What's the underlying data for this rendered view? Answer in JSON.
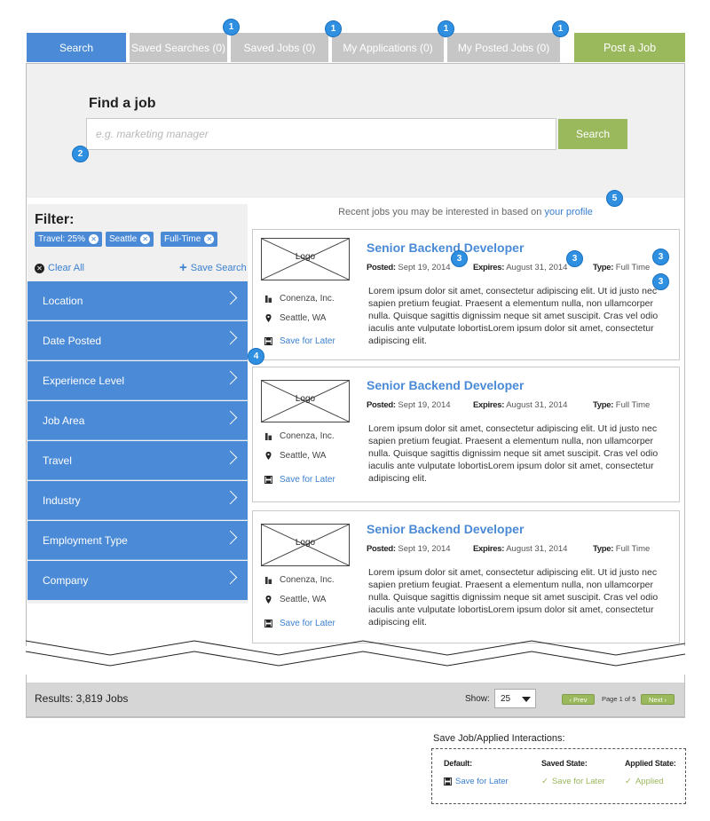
{
  "tabs": [
    {
      "label": "Search",
      "badge": ""
    },
    {
      "label": "Saved Searches (0)",
      "badge": "1"
    },
    {
      "label": "Saved Jobs (0)",
      "badge": "1"
    },
    {
      "label": "My Applications (0)",
      "badge": "1"
    },
    {
      "label": "My Posted Jobs (0)",
      "badge": "1"
    }
  ],
  "post_job_label": "Post a Job",
  "search": {
    "title": "Find a job",
    "placeholder": "e.g. marketing manager",
    "button_label": "Search",
    "badge": "2"
  },
  "filter": {
    "title": "Filter:",
    "chips": [
      "Travel: 25%",
      "Seattle",
      "Full-Time"
    ],
    "clear_all": "Clear All",
    "save_search": "Save Search",
    "facets": [
      "Location",
      "Date Posted",
      "Experience Level",
      "Job Area",
      "Travel",
      "Industry",
      "Employment Type",
      "Company"
    ]
  },
  "recent": {
    "text": "Recent jobs you may be interested in based on ",
    "link": "your profile",
    "badge": "5"
  },
  "jobs": [
    {
      "logo": "Logo",
      "title": "Senior Backend Developer",
      "posted_label": "Posted:",
      "posted": "Sept 19, 2014",
      "expires_label": "Expires:",
      "expires": "August 31, 2014",
      "type_label": "Type:",
      "type": "Full Time",
      "company": "Conenza, Inc.",
      "location": "Seattle, WA",
      "save": "Save for Later",
      "description": "Lorem ipsum dolor sit amet, consectetur adipiscing elit. Ut id justo nec sapien pretium feugiat. Praesent a elementum nulla, non ullamcorper nulla. Quisque sagittis dignissim neque sit amet suscipit. Cras vel odio iaculis ante vulputate lobortisLorem ipsum dolor sit amet, consectetur adipiscing elit."
    },
    {
      "logo": "Logo",
      "title": "Senior Backend Developer",
      "posted_label": "Posted:",
      "posted": "Sept 19, 2014",
      "expires_label": "Expires:",
      "expires": "August 31, 2014",
      "type_label": "Type:",
      "type": "Full Time",
      "company": "Conenza, Inc.",
      "location": "Seattle, WA",
      "save": "Save for Later",
      "description": "Lorem ipsum dolor sit amet, consectetur adipiscing elit. Ut id justo nec sapien pretium feugiat. Praesent a elementum nulla, non ullamcorper nulla. Quisque sagittis dignissim neque sit amet suscipit. Cras vel odio iaculis ante vulputate lobortisLorem ipsum dolor sit amet, consectetur adipiscing elit."
    },
    {
      "logo": "Logo",
      "title": "Senior Backend Developer",
      "posted_label": "Posted:",
      "posted": "Sept 19, 2014",
      "expires_label": "Expires:",
      "expires": "August 31, 2014",
      "type_label": "Type:",
      "type": "Full Time",
      "company": "Conenza, Inc.",
      "location": "Seattle, WA",
      "save": "Save for Later",
      "description": "Lorem ipsum dolor sit amet, consectetur adipiscing elit. Ut id justo nec sapien pretium feugiat. Praesent a elementum nulla, non ullamcorper nulla. Quisque sagittis dignissim neque sit amet suscipit. Cras vel odio iaculis ante vulputate lobortisLorem ipsum dolor sit amet, consectetur adipiscing elit."
    }
  ],
  "annotations": {
    "card_badge": "3",
    "save_badge": "4"
  },
  "footer": {
    "results": "Results: 3,819 Jobs",
    "show_label": "Show:",
    "show_value": "25",
    "prev": "Prev",
    "page_info": "Page 1 of 5",
    "next": "Next"
  },
  "legend": {
    "title": "Save Job/Applied Interactions:",
    "default_head": "Default:",
    "saved_head": "Saved State:",
    "applied_head": "Applied State:",
    "default_val": "Save for Later",
    "saved_val": "Save for Later",
    "applied_val": "Applied"
  },
  "colors": {
    "accent_blue": "#4a8ad6",
    "accent_green": "#9ab85c",
    "tab_gray": "#c6c6c6",
    "badge_blue": "#2f8fe0",
    "link_blue": "#3a7fd0"
  }
}
